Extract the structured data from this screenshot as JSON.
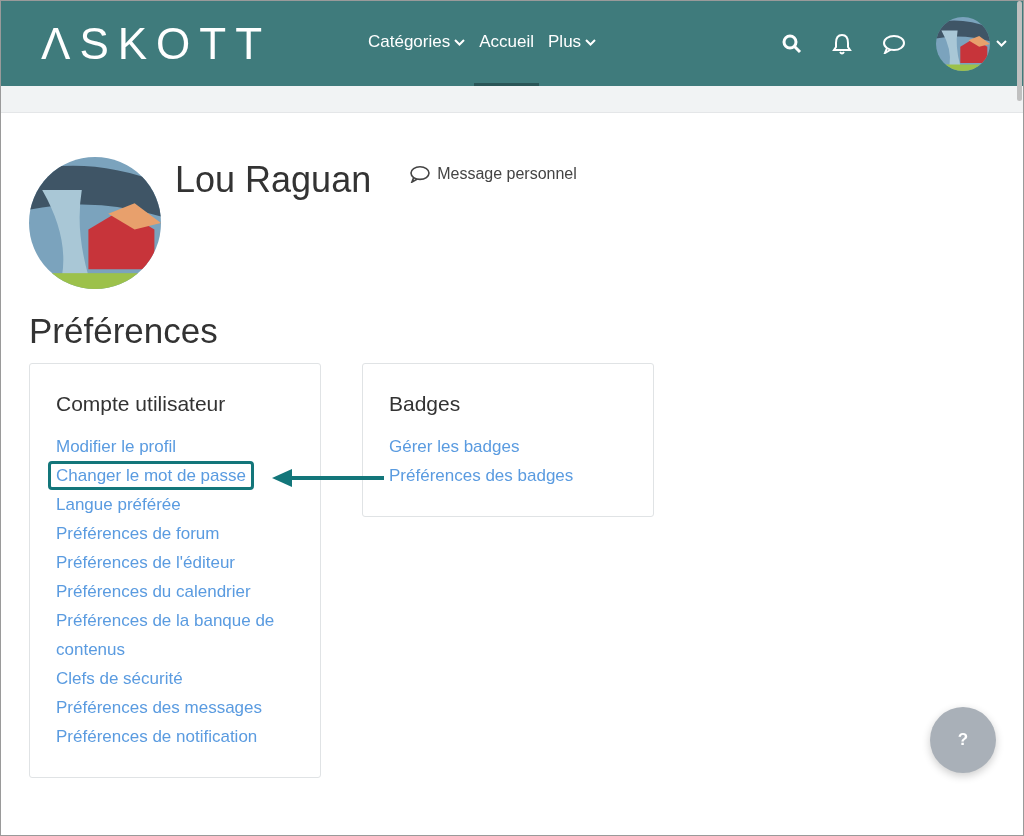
{
  "header": {
    "logo": "ΛSKOTT",
    "nav": [
      {
        "label": "Catégories",
        "dropdown": true,
        "selected": false
      },
      {
        "label": "Accueil",
        "dropdown": false,
        "selected": true
      },
      {
        "label": "Plus",
        "dropdown": true,
        "selected": false
      }
    ]
  },
  "profile": {
    "name": "Lou Raguan",
    "message_link": "Message personnel"
  },
  "page_title": "Préférences",
  "cards": [
    {
      "title": "Compte utilisateur",
      "links": [
        {
          "label": "Modifier le profil",
          "highlighted": false
        },
        {
          "label": "Changer le mot de passe",
          "highlighted": true
        },
        {
          "label": "Langue préférée",
          "highlighted": false
        },
        {
          "label": "Préférences de forum",
          "highlighted": false
        },
        {
          "label": "Préférences de l'éditeur",
          "highlighted": false
        },
        {
          "label": "Préférences du calendrier",
          "highlighted": false
        },
        {
          "label": "Préférences de la banque de contenus",
          "highlighted": false
        },
        {
          "label": "Clefs de sécurité",
          "highlighted": false
        },
        {
          "label": "Préférences des messages",
          "highlighted": false
        },
        {
          "label": "Préférences de notification",
          "highlighted": false
        }
      ]
    },
    {
      "title": "Badges",
      "links": [
        {
          "label": "Gérer les badges",
          "highlighted": false
        },
        {
          "label": "Préférences des badges",
          "highlighted": false
        }
      ]
    }
  ],
  "help_button": "?"
}
